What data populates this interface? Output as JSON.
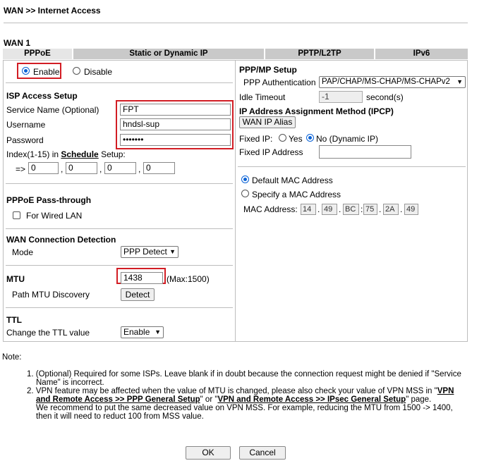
{
  "breadcrumb": "WAN >> Internet Access",
  "section_title": "WAN 1",
  "tabs": [
    "PPPoE",
    "Static or Dynamic IP",
    "PPTP/L2TP",
    "IPv6"
  ],
  "enable": {
    "enable_label": "Enable",
    "disable_label": "Disable",
    "selected": "Enable"
  },
  "isp": {
    "heading": "ISP Access Setup",
    "service_name_label": "Service Name (Optional)",
    "service_name_value": "FPT",
    "username_label": "Username",
    "username_value": "hndsl-sup",
    "password_label": "Password",
    "password_value": "•••••••",
    "index_label_prefix": "Index(1-15) in ",
    "index_schedule_link": "Schedule",
    "index_label_suffix": " Setup:",
    "arrow": "=>",
    "index_values": [
      "0",
      "0",
      "0",
      "0"
    ],
    "separators": [
      ",",
      ",",
      ","
    ]
  },
  "passthrough": {
    "heading": "PPPoE Pass-through",
    "wired_label": "For Wired LAN",
    "wired_checked": false
  },
  "detection": {
    "heading": "WAN Connection Detection",
    "mode_label": "Mode",
    "mode_value": "PPP Detect"
  },
  "mtu": {
    "heading": "MTU",
    "value": "1438",
    "max_label": "(Max:1500)",
    "path_label": "Path MTU Discovery",
    "detect_label": "Detect"
  },
  "ttl": {
    "heading": "TTL",
    "change_label": "Change the TTL value",
    "value": "Enable"
  },
  "ppp": {
    "heading": "PPP/MP Setup",
    "auth_label": "PPP Authentication",
    "auth_value": "PAP/CHAP/MS-CHAP/MS-CHAPv2",
    "idle_label": "Idle Timeout",
    "idle_value": "-1",
    "idle_unit": "second(s)"
  },
  "ipcp": {
    "heading": "IP Address Assignment Method (IPCP)",
    "alias_button": "WAN IP Alias",
    "fixed_ip_label": "Fixed IP:",
    "yes_label": "Yes",
    "no_label": "No (Dynamic IP)",
    "selected": "No",
    "fixed_addr_label": "Fixed IP Address",
    "fixed_addr_value": ""
  },
  "mac": {
    "default_label": "Default MAC Address",
    "specify_label": "Specify a MAC Address",
    "selected": "Default",
    "address_label": "MAC Address:",
    "octets": [
      "14",
      "49",
      "BC",
      "75",
      "2A",
      "49"
    ],
    "separators": [
      ".",
      ".",
      ":",
      ".",
      "."
    ]
  },
  "notes": {
    "title": "Note:",
    "item1": "1. (Optional) Required for some ISPs. Leave blank if in doubt because the connection request might be denied if \"Service",
    "item1_cont": "Name\" is incorrect.",
    "item2_a": "2. VPN feature may be affected when the value of MTU is changed, please also check your value of VPN MSS in \"",
    "item2_link1a": "VPN",
    "item2_link1b": "and Remote Access >> PPP General Setup",
    "item2_mid": "\" or \"",
    "item2_link2": "VPN and Remote Access >> IPsec General Setup",
    "item2_end": "\" page.",
    "item2_line3": "We recommend to put the same decreased value on VPN MSS. For example, reducing the MTU from 1500 -> 1400,",
    "item2_line4": "then it will need to reduct 100 from MSS value."
  },
  "buttons": {
    "ok": "OK",
    "cancel": "Cancel"
  },
  "colors": {
    "highlight": "#d21d24",
    "radio_selected": "#0a62d6",
    "tab_bg": "#c9c9c9"
  }
}
